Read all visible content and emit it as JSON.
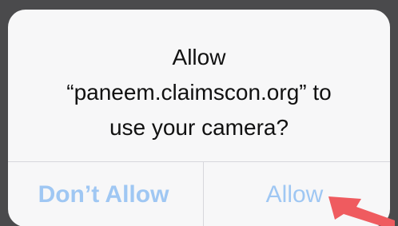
{
  "dialog": {
    "title_line1": "Allow",
    "title_line2": "“paneem.claimscon.org” to",
    "title_line3": "use your camera?"
  },
  "buttons": {
    "dont_allow": "Don’t Allow",
    "allow": "Allow"
  },
  "colors": {
    "background": "#4a4a4c",
    "alert": "#f7f7f8",
    "button_text": "#9fc7f3",
    "pointer": "#ef5b5f"
  },
  "icons": {
    "pointer": "arrow-pointer-icon"
  }
}
